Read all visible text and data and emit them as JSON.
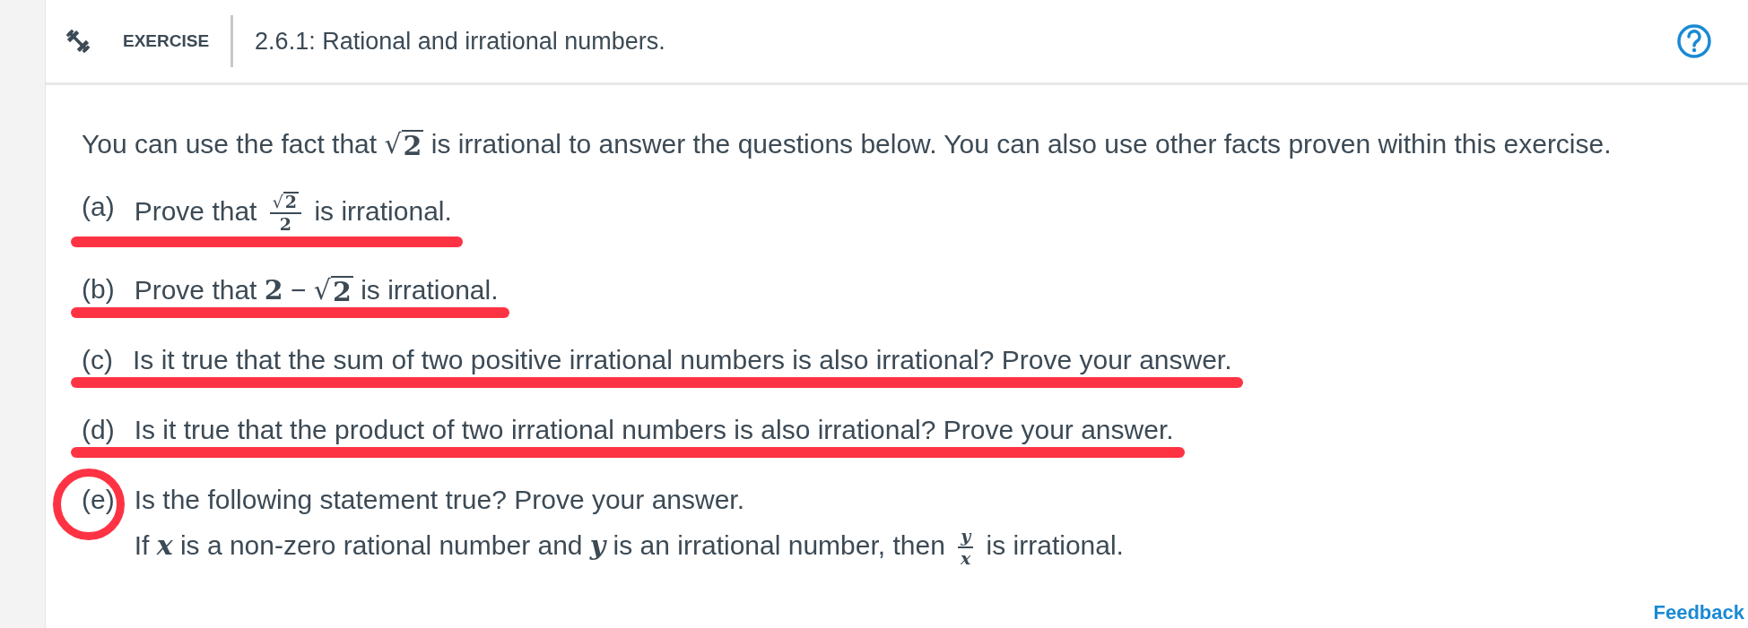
{
  "header": {
    "badge": "EXERCISE",
    "title": "2.6.1: Rational and irrational numbers."
  },
  "intro": [
    {
      "kind": "text",
      "text": "You can use the fact that "
    },
    {
      "kind": "sqrt",
      "sign": "√",
      "radicand": "2"
    },
    {
      "kind": "text",
      "text": " is irrational to answer the questions below. You can also use other facts proven within this exercise."
    }
  ],
  "items": [
    {
      "label": "(a)",
      "struck": true,
      "circled": false,
      "lines": [
        [
          {
            "kind": "text",
            "text": "Prove that "
          },
          {
            "kind": "frac",
            "num": [
              {
                "kind": "sqrt",
                "sign": "√",
                "radicand": "2"
              }
            ],
            "den": [
              {
                "kind": "num",
                "text": "2"
              }
            ]
          },
          {
            "kind": "text",
            "text": " is irrational."
          }
        ]
      ]
    },
    {
      "label": "(b)",
      "struck": true,
      "circled": false,
      "lines": [
        [
          {
            "kind": "text",
            "text": "Prove that "
          },
          {
            "kind": "num",
            "text": "2"
          },
          {
            "kind": "text",
            "text": " − "
          },
          {
            "kind": "sqrt",
            "sign": "√",
            "radicand": "2"
          },
          {
            "kind": "text",
            "text": " is irrational."
          }
        ]
      ]
    },
    {
      "label": "(c)",
      "struck": true,
      "circled": false,
      "lines": [
        [
          {
            "kind": "text",
            "text": "Is it true that the sum of two positive irrational numbers is also irrational? Prove your answer."
          }
        ]
      ]
    },
    {
      "label": "(d)",
      "struck": true,
      "circled": false,
      "lines": [
        [
          {
            "kind": "text",
            "text": "Is it true that the product of two irrational numbers is also irrational? Prove your answer."
          }
        ]
      ]
    },
    {
      "label": "(e)",
      "struck": false,
      "circled": true,
      "lines": [
        [
          {
            "kind": "text",
            "text": "Is the following statement true? Prove your answer."
          }
        ],
        [
          {
            "kind": "text",
            "text": "If "
          },
          {
            "kind": "var",
            "text": "x"
          },
          {
            "kind": "text",
            "text": " is a non-zero rational number and "
          },
          {
            "kind": "var",
            "text": "y"
          },
          {
            "kind": "text",
            "text": " is an irrational number, then "
          },
          {
            "kind": "frac",
            "num": [
              {
                "kind": "var",
                "text": "y"
              }
            ],
            "den": [
              {
                "kind": "var",
                "text": "x"
              }
            ]
          },
          {
            "kind": "text",
            "text": " is irrational."
          }
        ]
      ]
    }
  ],
  "feedback": "Feedback"
}
